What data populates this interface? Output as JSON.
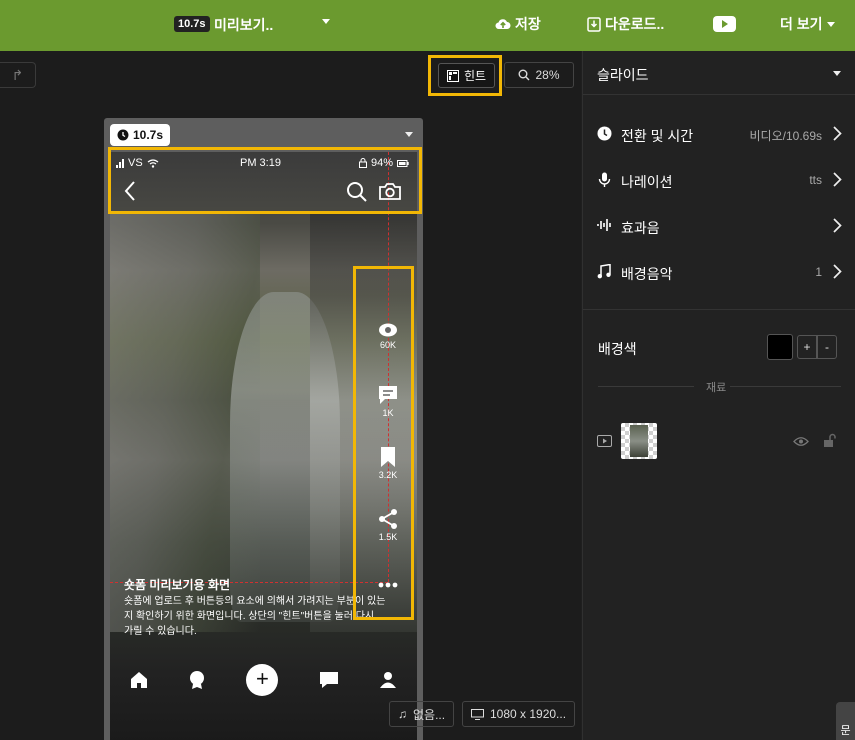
{
  "topbar": {
    "duration_badge": "10.7s",
    "title": "미리보기..",
    "save_label": "저장",
    "download_label": "다운로드..",
    "more_label": "더 보기"
  },
  "canvas_toolbar": {
    "hint_label": "힌트",
    "zoom_label": "28%"
  },
  "slide": {
    "duration": "10.7s",
    "status_bar": {
      "carrier": "VS",
      "time": "PM 3:19",
      "battery": "94%"
    },
    "actions": [
      {
        "icon": "eye-icon",
        "count": "60K"
      },
      {
        "icon": "comment-icon",
        "count": "1K"
      },
      {
        "icon": "bookmark-icon",
        "count": "3.2K"
      },
      {
        "icon": "share-icon",
        "count": "1.5K"
      },
      {
        "icon": "more-icon",
        "count": ""
      }
    ],
    "caption_title": "숏폼 미리보기용 화면",
    "caption_body": "숏폼에 업로드 후 버튼등의 요소에 의해서 가려지는 부분이 있는지 확인하기 위한 화면입니다. 상단의 \"힌트\"버튼을 눌러 다시 가릴 수 있습니다."
  },
  "canvas_bottom": {
    "music_label": "없음...",
    "resolution_label": "1080 x 1920..."
  },
  "panel": {
    "header": "슬라이드",
    "rows": [
      {
        "label": "전환 및 시간",
        "value": "비디오/10.69s",
        "icon": "clock-icon"
      },
      {
        "label": "나레이션",
        "value": "tts",
        "icon": "mic-icon"
      },
      {
        "label": "효과음",
        "value": "",
        "icon": "soundwave-icon"
      },
      {
        "label": "배경음악",
        "value": "1",
        "icon": "music-icon"
      }
    ],
    "bg_color_label": "배경색",
    "bg_color": "#000000",
    "plus_label": "+",
    "minus_label": "-",
    "materials_label": "재료"
  },
  "corner_tab_label": "문",
  "colors": {
    "topbar": "#6b9a2f",
    "highlight": "#f2b705",
    "guide": "#d03030"
  }
}
